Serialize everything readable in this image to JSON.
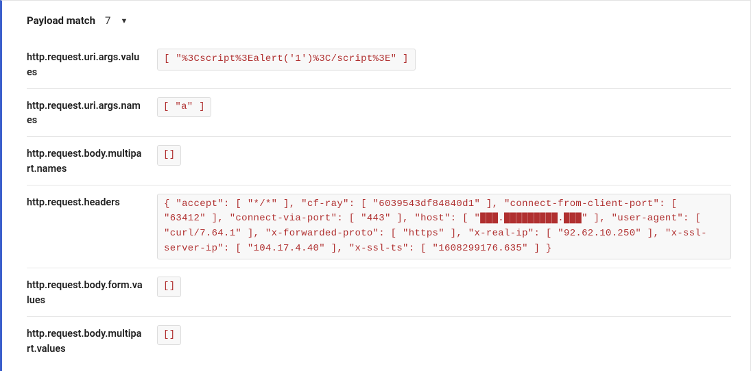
{
  "section": {
    "title": "Payload match",
    "count": "7"
  },
  "rows": [
    {
      "label": "http.request.uri.args.values",
      "value": "[ \"%3Cscript%3Ealert('1')%3C/script%3E\" ]"
    },
    {
      "label": "http.request.uri.args.names",
      "value": "[ \"a\" ]"
    },
    {
      "label": "http.request.body.multipart.names",
      "value": "[]"
    },
    {
      "label": "http.request.headers",
      "value": "{ \"accept\": [ \"*/*\" ], \"cf-ray\": [ \"6039543df84840d1\" ], \"connect-from-client-port\": [ \"63412\" ], \"connect-via-port\": [ \"443\" ], \"host\": [ \"███.█████████.███\" ], \"user-agent\": [ \"curl/7.64.1\" ], \"x-forwarded-proto\": [ \"https\" ], \"x-real-ip\": [ \"92.62.10.250\" ], \"x-ssl-server-ip\": [ \"104.17.4.40\" ], \"x-ssl-ts\": [ \"1608299176.635\" ] }"
    },
    {
      "label": "http.request.body.form.values",
      "value": "[]"
    },
    {
      "label": "http.request.body.multipart.values",
      "value": "[]"
    }
  ]
}
